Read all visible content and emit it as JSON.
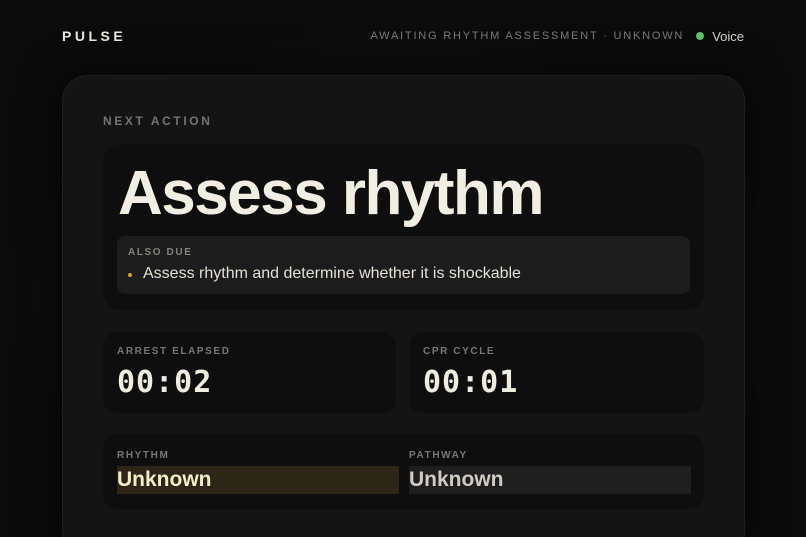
{
  "header": {
    "brand": "PULSE",
    "status": "AWAITING RHYTHM ASSESSMENT · UNKNOWN",
    "voice_label": "Voice",
    "voice_color": "#5cc26a"
  },
  "next_action": {
    "section_label": "NEXT ACTION",
    "title": "Assess rhythm",
    "also_due_label": "ALSO DUE",
    "also_due_items": [
      "Assess rhythm and determine whether it is shockable"
    ],
    "bullet_color": "#d9a032"
  },
  "timers": {
    "arrest_label": "ARREST ELAPSED",
    "arrest_value": "00:02",
    "cpr_label": "CPR CYCLE",
    "cpr_value": "00:01"
  },
  "status": {
    "rhythm_label": "RHYTHM",
    "rhythm_value": "Unknown",
    "pathway_label": "PATHWAY",
    "pathway_value": "Unknown"
  }
}
